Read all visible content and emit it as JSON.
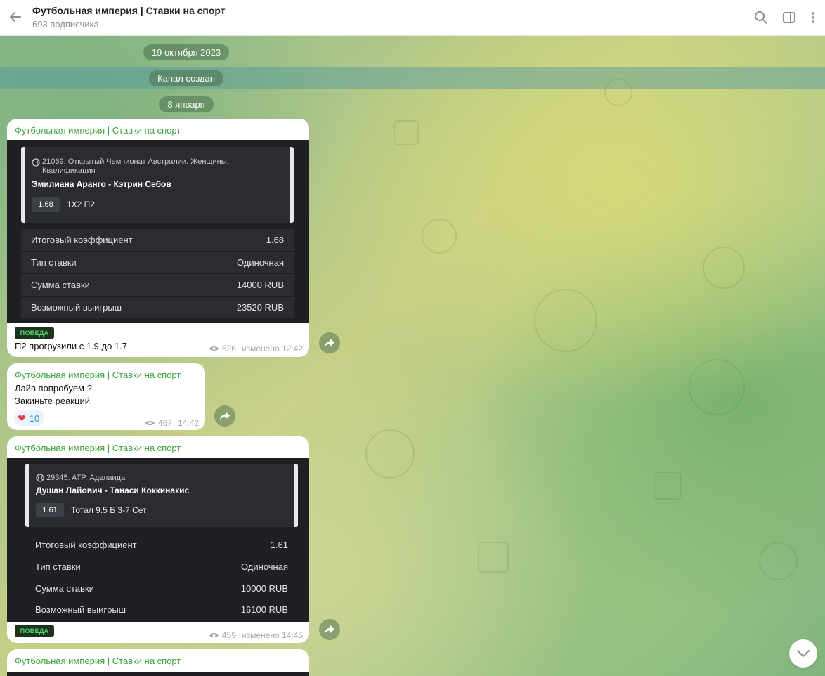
{
  "header": {
    "title": "Футбольная империя | Ставки на спорт",
    "subtitle": "693 подписчика",
    "icons": [
      "back-arrow-icon",
      "search-icon",
      "sidebar-toggle-icon",
      "more-vert-icon"
    ]
  },
  "service": {
    "date1": "19 октября 2023",
    "created": "Канал создан",
    "date2": "8 января"
  },
  "messages": [
    {
      "author": "Футбольная империя | Ставки на спорт",
      "card": {
        "league": "21069. Открытый Чемпионат Австралии. Женщины. Квалификация",
        "match": "Эмилиана Аранго - Кэтрин Себов",
        "odd": "1.68",
        "market": "1X2 П2"
      },
      "summary": [
        {
          "label": "Итоговый коэффициент",
          "value": "1.68"
        },
        {
          "label": "Тип ставки",
          "value": "Одиночная"
        },
        {
          "label": "Сумма ставки",
          "value": "14000 RUB"
        },
        {
          "label": "Возможный выигрыш",
          "value": "23520 RUB"
        }
      ],
      "badge": "ПОБЕДА",
      "text": "П2 прогрузили с 1.9 до 1.7",
      "views": "526",
      "time": "изменено 12:42"
    },
    {
      "author": "Футбольная империя | Ставки на спорт",
      "line1": "Лайв попробуем ?",
      "line2": "Закиньте реакций",
      "reaction_emoji": "❤",
      "reaction_count": "10",
      "views": "467",
      "time": "14:42"
    },
    {
      "author": "Футбольная империя | Ставки на спорт",
      "card": {
        "league": "29345. ATP. Аделаида",
        "match": "Душан Лайович - Танаси Коккинакис",
        "odd": "1.61",
        "market": "Тотал 9.5 Б 3-й Сет"
      },
      "summary": [
        {
          "label": "Итоговый коэффициент",
          "value": "1.61"
        },
        {
          "label": "Тип ставки",
          "value": "Одиночная"
        },
        {
          "label": "Сумма ставки",
          "value": "10000 RUB"
        },
        {
          "label": "Возможный выигрыш",
          "value": "16100 RUB"
        }
      ],
      "badge": "ПОБЕДА",
      "views": "459",
      "time": "изменено 14:45"
    },
    {
      "author": "Футбольная империя | Ставки на спорт"
    }
  ],
  "colors": {
    "author": "#3aa33a",
    "badge_text": "#4fd36b",
    "card_bg": "#1e2024",
    "reaction": "#2f8fd6"
  }
}
